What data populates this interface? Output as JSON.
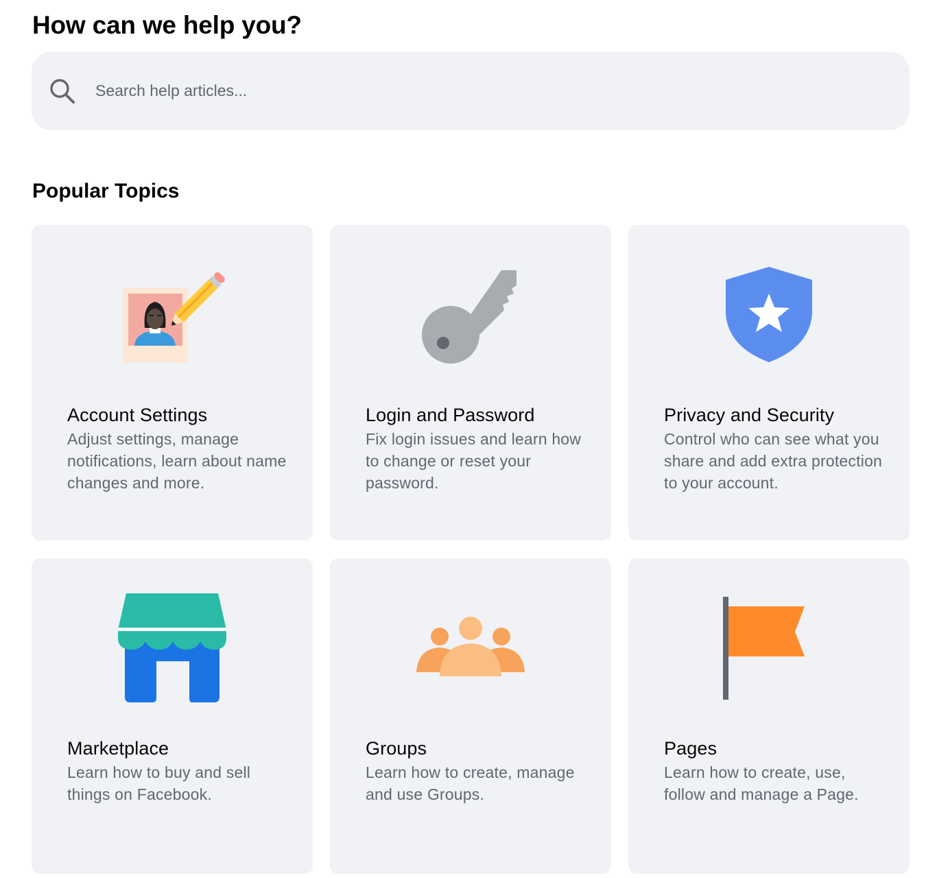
{
  "header": {
    "title": "How can we help you?"
  },
  "search": {
    "placeholder": "Search help articles...",
    "icon": "search-icon"
  },
  "popular_topics": {
    "title": "Popular Topics",
    "cards": [
      {
        "title": "Account Settings",
        "description": "Adjust settings, manage notifications, learn about name changes and more.",
        "icon": "profile-photo-pencil-icon"
      },
      {
        "title": "Login and Password",
        "description": "Fix login issues and learn how to change or reset your password.",
        "icon": "key-icon"
      },
      {
        "title": "Privacy and Security",
        "description": "Control who can see what you share and add extra protection to your account.",
        "icon": "shield-star-icon"
      },
      {
        "title": "Marketplace",
        "description": "Learn how to buy and sell things on Facebook.",
        "icon": "storefront-icon"
      },
      {
        "title": "Groups",
        "description": "Learn how to create, manage and use Groups.",
        "icon": "people-group-icon"
      },
      {
        "title": "Pages",
        "description": "Learn how to create, use, follow and manage a Page.",
        "icon": "flag-icon"
      }
    ]
  },
  "colors": {
    "card_background": "#f0f2f5",
    "secondary_text": "#606770",
    "shield_blue": "#5b8def",
    "store_teal": "#2abba7",
    "store_blue": "#1b74e4",
    "groups_orange": "#f7a35c",
    "flag_orange": "#ff8a2b",
    "key_gray": "#a8abaf"
  }
}
